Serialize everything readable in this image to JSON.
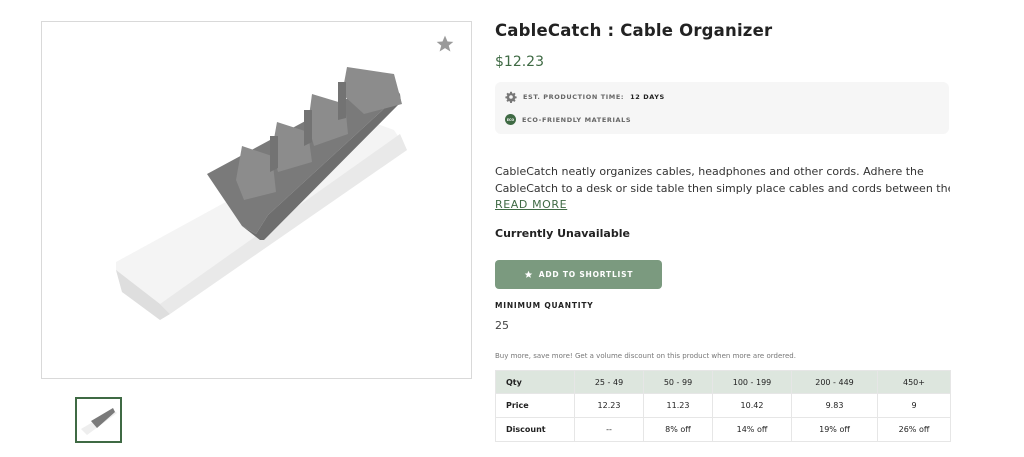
{
  "product": {
    "title": "CableCatch : Cable Organizer",
    "price": "$12.23",
    "favorite_icon": "star-icon"
  },
  "info": {
    "production_label": "EST. PRODUCTION TIME:",
    "production_value": "12 DAYS",
    "production_icon": "gear-icon",
    "eco_label": "ECO-FRIENDLY MATERIALS",
    "eco_badge": "ECO"
  },
  "description": {
    "line1": "CableCatch neatly organizes cables, headphones and other cords. Adhere the",
    "line2": "CableCatch to a desk or side table then simply place cables and cords between the…",
    "read_more": "READ MORE"
  },
  "availability": "Currently Unavailable",
  "shortlist_button": "ADD TO SHORTLIST",
  "minimum_quantity": {
    "label": "MINIMUM QUANTITY",
    "value": "25"
  },
  "volume_note": "Buy more, save more! Get a volume discount on this product when more are ordered.",
  "pricing_table": {
    "header": [
      "Qty",
      "25 - 49",
      "50 - 99",
      "100 - 199",
      "200 - 449",
      "450+"
    ],
    "price": [
      "Price",
      "12.23",
      "11.23",
      "10.42",
      "9.83",
      "9"
    ],
    "discount": [
      "Discount",
      "--",
      "8% off",
      "14% off",
      "19% off",
      "26% off"
    ]
  },
  "colors": {
    "brand_green": "#3f6a44",
    "button_green": "#7b9a7f",
    "table_header": "#dde6de",
    "info_box": "#f6f6f6"
  }
}
